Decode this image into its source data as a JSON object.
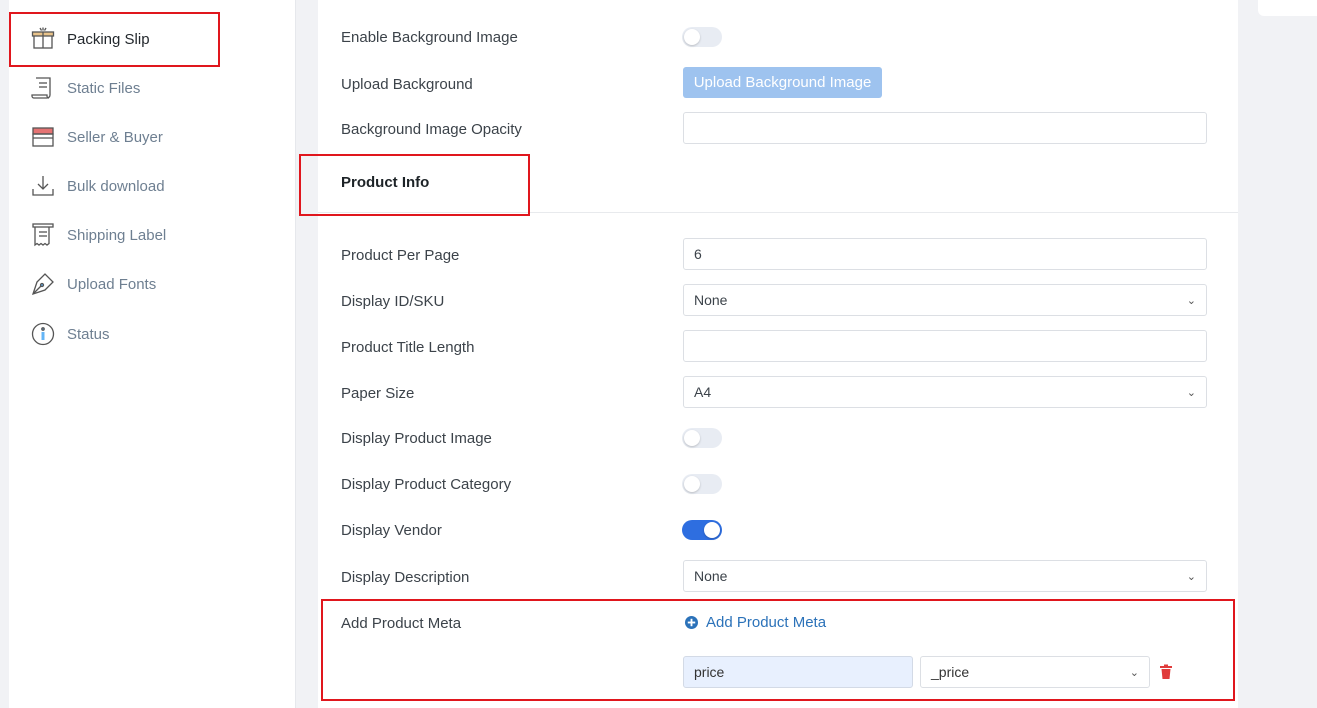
{
  "sidebar": {
    "items": [
      {
        "label": "Packing Slip",
        "icon": "box-icon"
      },
      {
        "label": "Static Files",
        "icon": "document-icon"
      },
      {
        "label": "Seller & Buyer",
        "icon": "store-icon"
      },
      {
        "label": "Bulk download",
        "icon": "download-icon"
      },
      {
        "label": "Shipping Label",
        "icon": "receipt-icon"
      },
      {
        "label": "Upload Fonts",
        "icon": "pen-icon"
      },
      {
        "label": "Status",
        "icon": "info-icon"
      }
    ]
  },
  "form": {
    "enable_bg_image": {
      "label": "Enable Background Image",
      "on": false
    },
    "upload_bg": {
      "label": "Upload Background",
      "button": "Upload Background Image"
    },
    "bg_opacity": {
      "label": "Background Image Opacity",
      "value": ""
    },
    "section_title": "Product Info",
    "product_per_page": {
      "label": "Product Per Page",
      "value": "6"
    },
    "display_id_sku": {
      "label": "Display ID/SKU",
      "value": "None"
    },
    "product_title_length": {
      "label": "Product Title Length",
      "value": ""
    },
    "paper_size": {
      "label": "Paper Size",
      "value": "A4"
    },
    "display_product_image": {
      "label": "Display Product Image",
      "on": false
    },
    "display_product_category": {
      "label": "Display Product Category",
      "on": false
    },
    "display_vendor": {
      "label": "Display Vendor",
      "on": true
    },
    "display_description": {
      "label": "Display Description",
      "value": "None"
    },
    "add_product_meta": {
      "label": "Add Product Meta",
      "link": "Add Product Meta",
      "meta_key": "price",
      "meta_value": "_price"
    }
  },
  "colors": {
    "accent": "#2e6ee0",
    "highlight": "#e0161d",
    "link": "#2b72b9",
    "button": "#9ec3ef"
  }
}
